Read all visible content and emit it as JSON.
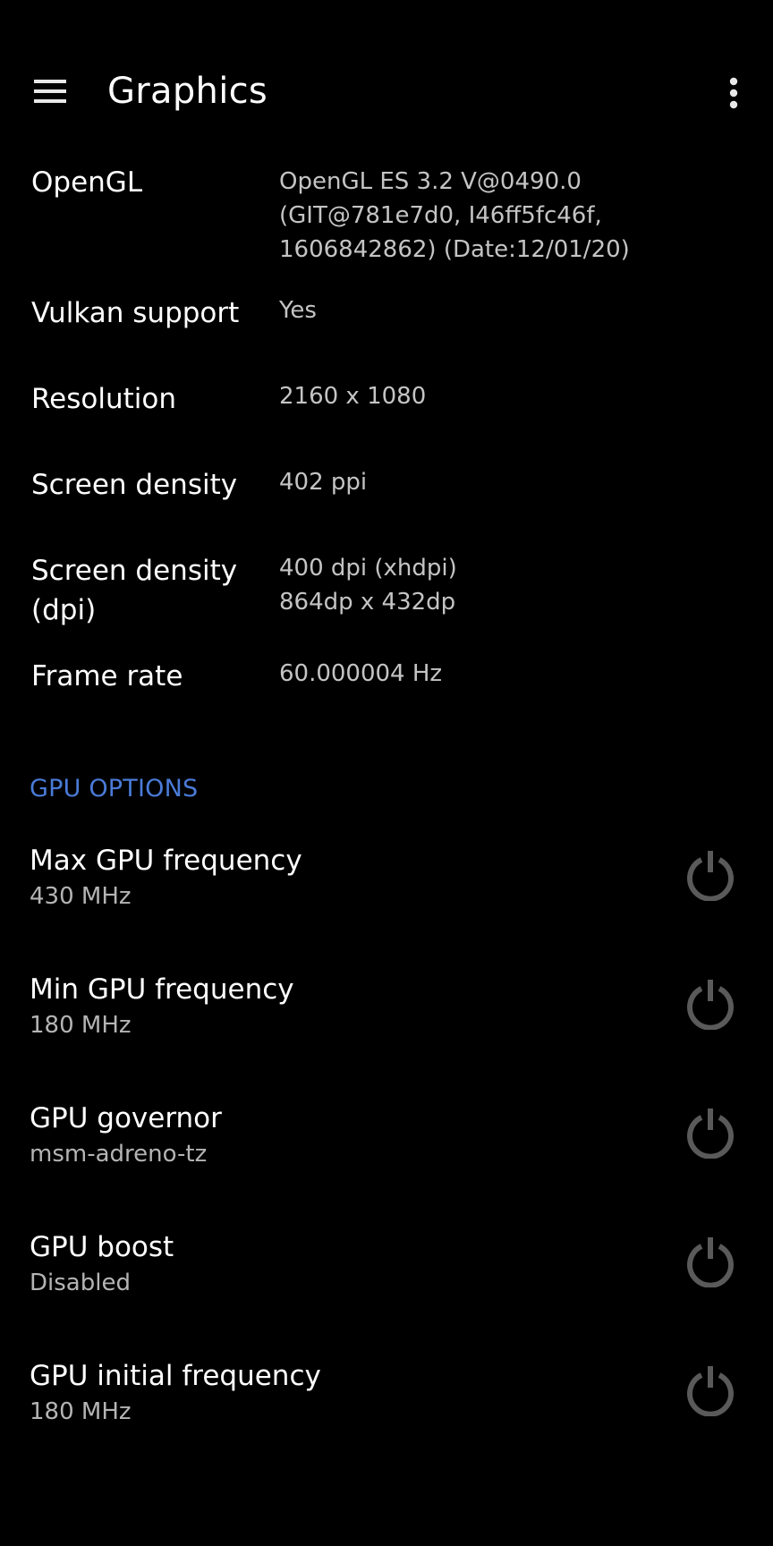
{
  "appbar": {
    "title": "Graphics",
    "menu_icon": "hamburger-menu-icon",
    "overflow_icon": "more-vertical-icon"
  },
  "info": [
    {
      "label": "OpenGL",
      "value_lines": [
        "OpenGL ES 3.2 V@0490.0",
        "(GIT@781e7d0, I46ff5fc46f,",
        "1606842862) (Date:12/01/20)"
      ]
    },
    {
      "label": "Vulkan support",
      "value_lines": [
        "Yes"
      ]
    },
    {
      "label": "Resolution",
      "value_lines": [
        "2160 x 1080"
      ]
    },
    {
      "label": "Screen density",
      "value_lines": [
        "402 ppi"
      ]
    },
    {
      "label_lines": [
        "Screen density",
        "(dpi)"
      ],
      "value_lines": [
        "400 dpi (xhdpi)",
        "864dp x 432dp"
      ]
    },
    {
      "label": "Frame rate",
      "value_lines": [
        "60.000004 Hz"
      ]
    }
  ],
  "gpu_options": {
    "header": "GPU OPTIONS",
    "items": [
      {
        "title": "Max GPU frequency",
        "value": "430 MHz"
      },
      {
        "title": "Min GPU frequency",
        "value": "180 MHz"
      },
      {
        "title": "GPU governor",
        "value": "msm-adreno-tz"
      },
      {
        "title": "GPU boost",
        "value": "Disabled"
      },
      {
        "title": "GPU initial frequency",
        "value": "180 MHz"
      }
    ],
    "power_icon": "power-icon"
  },
  "colors": {
    "background": "#000000",
    "accent": "#4a7bd8",
    "label": "#ffffff",
    "value": "#c4c4c4",
    "icon_muted": "#5a5a5a"
  }
}
